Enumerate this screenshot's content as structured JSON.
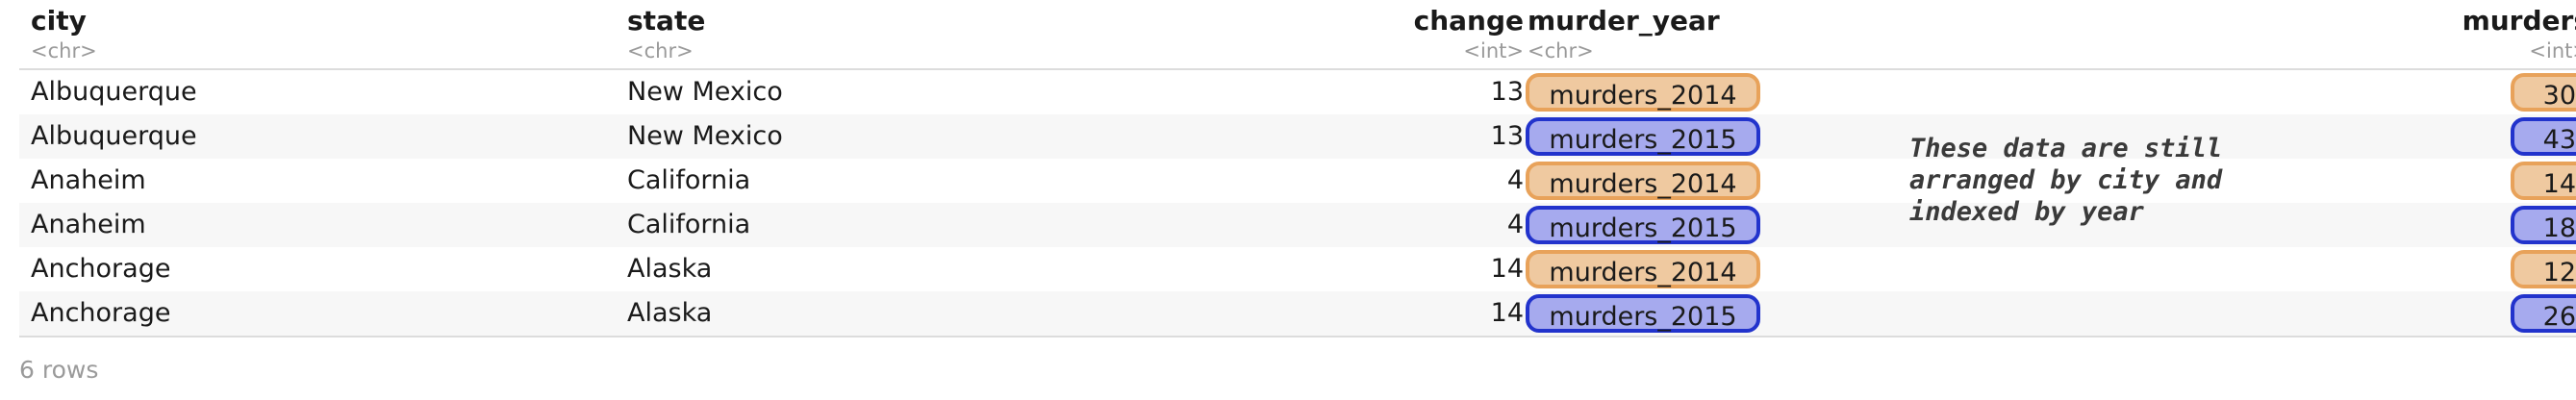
{
  "table": {
    "columns": [
      {
        "name": "city",
        "type": "<chr>"
      },
      {
        "name": "state",
        "type": "<chr>"
      },
      {
        "name": "change",
        "type": "<int>"
      },
      {
        "name": "murder_year",
        "type": "<chr>"
      },
      {
        "name": "murders",
        "type": "<int>"
      }
    ],
    "rows": [
      {
        "city": "Albuquerque",
        "state": "New Mexico",
        "change": "13",
        "murder_year": "murders_2014",
        "murders": "30"
      },
      {
        "city": "Albuquerque",
        "state": "New Mexico",
        "change": "13",
        "murder_year": "murders_2015",
        "murders": "43"
      },
      {
        "city": "Anaheim",
        "state": "California",
        "change": "4",
        "murder_year": "murders_2014",
        "murders": "14"
      },
      {
        "city": "Anaheim",
        "state": "California",
        "change": "4",
        "murder_year": "murders_2015",
        "murders": "18"
      },
      {
        "city": "Anchorage",
        "state": "Alaska",
        "change": "14",
        "murder_year": "murders_2014",
        "murders": "12"
      },
      {
        "city": "Anchorage",
        "state": "Alaska",
        "change": "14",
        "murder_year": "murders_2015",
        "murders": "26"
      }
    ]
  },
  "annotation": "These data are still arranged by city and indexed by year",
  "footer": "6 rows",
  "colors": {
    "murders_2014_fill": "#efc9a0",
    "murders_2014_border": "#e8a25a",
    "murders_2015_fill": "#a6aaee",
    "murders_2015_border": "#2233cc"
  }
}
